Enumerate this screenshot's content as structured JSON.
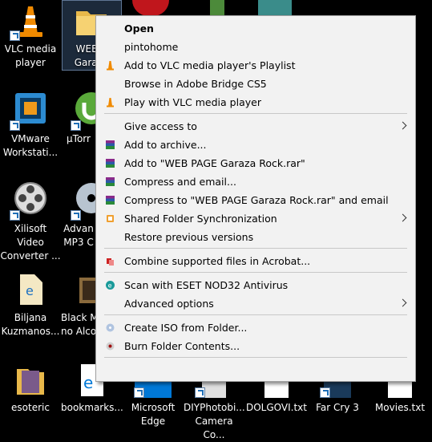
{
  "desktop": {
    "icons": [
      {
        "label": "VLC media player"
      },
      {
        "label": "WEB PAGE Garaza Rock"
      },
      {
        "label": "VMware Workstati..."
      },
      {
        "label": "µTorrent"
      },
      {
        "label": "Xilisoft Video Converter ..."
      },
      {
        "label": "Advanced MP3 C..."
      },
      {
        "label": "Biljana Kuzmanos..."
      },
      {
        "label": "Black M... no Alco..."
      },
      {
        "label": "esoteric"
      },
      {
        "label": "bookmarks..."
      },
      {
        "label": "Microsoft Edge"
      },
      {
        "label": "DIYPhotobi... Camera Co..."
      },
      {
        "label": "DOLGOVI.txt"
      },
      {
        "label": "Far Cry 3"
      },
      {
        "label": "Movies.txt"
      }
    ]
  },
  "menu": {
    "items": [
      {
        "label": "Open",
        "icon": "",
        "bold": true
      },
      {
        "label": "pintohome",
        "icon": ""
      },
      {
        "label": "Add to VLC media player's Playlist",
        "icon": "vlc-cone-icon"
      },
      {
        "label": "Browse in Adobe Bridge CS5",
        "icon": ""
      },
      {
        "label": "Play with VLC media player",
        "icon": "vlc-cone-icon"
      },
      {
        "label": "Give access to",
        "icon": "",
        "submenu": true
      },
      {
        "label": "Add to archive...",
        "icon": "winrar-icon"
      },
      {
        "label": "Add to \"WEB PAGE Garaza Rock.rar\"",
        "icon": "winrar-icon"
      },
      {
        "label": "Compress and email...",
        "icon": "winrar-icon"
      },
      {
        "label": "Compress to \"WEB PAGE Garaza Rock.rar\" and email",
        "icon": "winrar-icon"
      },
      {
        "label": "Shared Folder Synchronization",
        "icon": "sync-icon",
        "submenu": true
      },
      {
        "label": "Restore previous versions",
        "icon": ""
      },
      {
        "label": "Combine supported files in Acrobat...",
        "icon": "acrobat-icon"
      },
      {
        "label": "Scan with ESET NOD32 Antivirus",
        "icon": "eset-icon"
      },
      {
        "label": "Advanced options",
        "icon": "",
        "submenu": true
      },
      {
        "label": "Create ISO from Folder...",
        "icon": "disc-icon"
      },
      {
        "label": "Burn Folder Contents...",
        "icon": "burn-icon"
      }
    ]
  },
  "colors": {
    "menu_bg": "#f2f2f2",
    "desktop_bg": "#000000",
    "vlc_orange": "#f08a00",
    "edge_blue": "#0078d7"
  }
}
